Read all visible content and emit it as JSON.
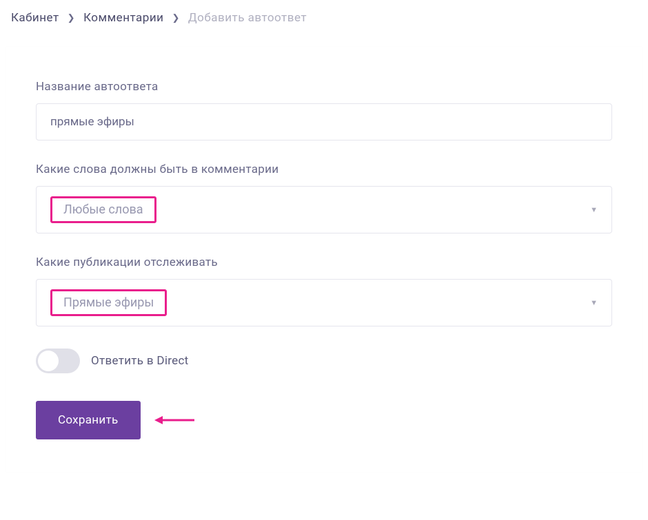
{
  "breadcrumb": {
    "items": [
      {
        "label": "Кабинет"
      },
      {
        "label": "Комментарии"
      }
    ],
    "current": "Добавить автоответ"
  },
  "form": {
    "name": {
      "label": "Название автоответа",
      "value": "прямые эфиры"
    },
    "words": {
      "label": "Какие слова должны быть в комментарии",
      "selected": "Любые слова"
    },
    "publications": {
      "label": "Какие публикации отслеживать",
      "selected": "Прямые эфиры"
    },
    "direct": {
      "label": "Ответить в Direct",
      "enabled": false
    },
    "save_label": "Сохранить"
  },
  "colors": {
    "primary": "#6b3fa0",
    "highlight": "#e91e8c"
  }
}
